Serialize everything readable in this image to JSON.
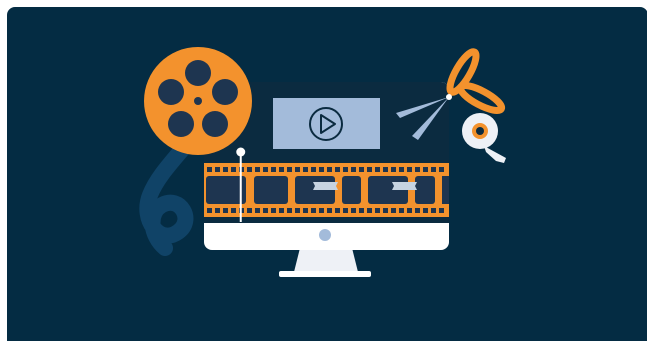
{
  "illustration": {
    "subject": "video-editing",
    "icons": [
      "film-reel-icon",
      "monitor-icon",
      "play-icon",
      "film-strip-icon",
      "scissors-icon",
      "tape-roll-icon",
      "playhead-marker-icon"
    ]
  },
  "colors": {
    "background": "#042c43",
    "accent_orange": "#f3922d",
    "monitor_body": "#ffffff",
    "screen_thumbnail": "#a3bbda",
    "screen_dark": "#0b2b40",
    "stand_light": "#eef1f6",
    "film_hole_fill": "#1e3550",
    "film_ribbon": "#12466b",
    "tape_patch": "#c6d3e1"
  },
  "playback": {
    "position": 0.15
  }
}
